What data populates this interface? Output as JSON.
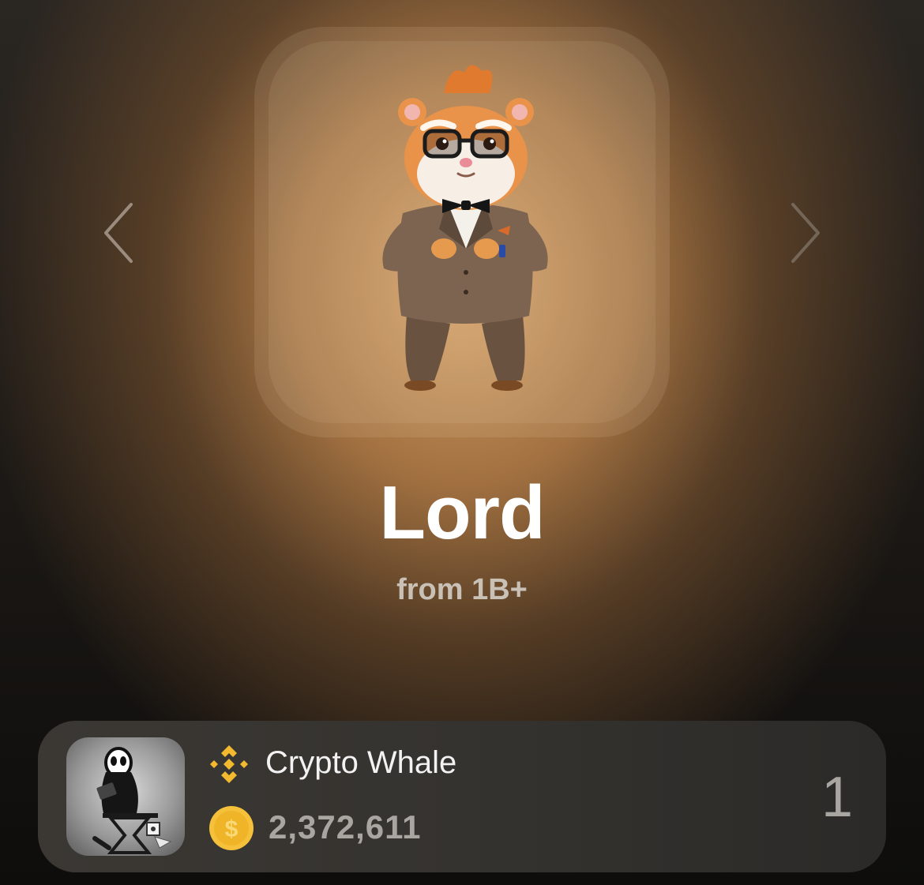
{
  "level": {
    "title": "Lord",
    "subtitle": "from 1B+",
    "character_image": "hamster-lord-image"
  },
  "navigation": {
    "prev_icon": "chevron-left-icon",
    "next_icon": "chevron-right-icon"
  },
  "player": {
    "name": "Crypto Whale",
    "exchange_icon": "binance-icon",
    "coin_icon": "dollar-coin-icon",
    "balance": "2,372,611",
    "rank": "1"
  },
  "colors": {
    "accent_gold": "#F3BA2F",
    "coin_gold": "#F5C13A",
    "title_white": "#FFFFFF",
    "muted_text": "#A9A6A2"
  }
}
